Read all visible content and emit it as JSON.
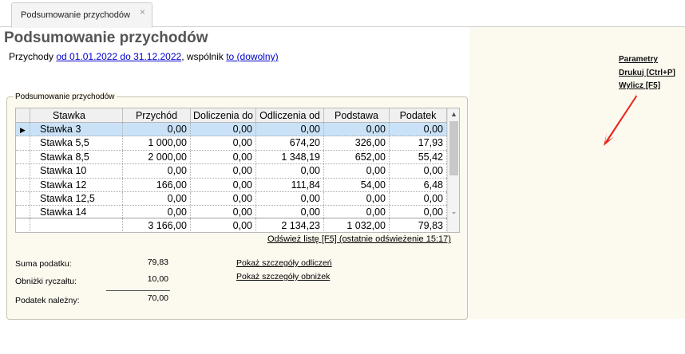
{
  "tab": {
    "label": "Podsumowanie przychodów",
    "close": "×"
  },
  "page": {
    "title": "Podsumowanie przychodów",
    "subtitle_prefix": "Przychody ",
    "date_range": "od 01.01.2022 do 31.12.2022",
    "subtitle_mid": ", wspólnik ",
    "partner": "to (dowolny)"
  },
  "side_menu": [
    "Parametry",
    "Drukuj [Ctrl+P]",
    "Wylicz [F5]"
  ],
  "accent_color": "#e8251c",
  "group": {
    "legend": "Podsumowanie przychodów"
  },
  "grid": {
    "columns": [
      "Stawka",
      "Przychód",
      "Doliczenia do",
      "Odliczenia od",
      "Podstawa",
      "Podatek"
    ],
    "rows": [
      [
        "Stawka 3",
        "0,00",
        "0,00",
        "0,00",
        "0,00",
        "0,00"
      ],
      [
        "Stawka 5,5",
        "1 000,00",
        "0,00",
        "674,20",
        "326,00",
        "17,93"
      ],
      [
        "Stawka 8,5",
        "2 000,00",
        "0,00",
        "1 348,19",
        "652,00",
        "55,42"
      ],
      [
        "Stawka 10",
        "0,00",
        "0,00",
        "0,00",
        "0,00",
        "0,00"
      ],
      [
        "Stawka 12",
        "166,00",
        "0,00",
        "111,84",
        "54,00",
        "6,48"
      ],
      [
        "Stawka 12,5",
        "0,00",
        "0,00",
        "0,00",
        "0,00",
        "0,00"
      ],
      [
        "Stawka 14",
        "0,00",
        "0,00",
        "0,00",
        "0,00",
        "0,00"
      ]
    ],
    "selected_row": 0,
    "totals": [
      "",
      "3 166,00",
      "0,00",
      "2 134,23",
      "1 032,00",
      "79,83"
    ],
    "refresh": "Odśwież listę [F5] (ostatnie odświeżenie 15:17)"
  },
  "summary": {
    "tax_sum_label": "Suma podatku:",
    "tax_sum_value": "79,83",
    "reductions_label": "Obniżki ryczałtu:",
    "reductions_value": "10,00",
    "due_label": "Podatek należny:",
    "due_value": "70,00"
  },
  "details": {
    "deductions": "Pokaż szczegóły odliczeń",
    "reductions": "Pokaż szczegóły obniżek"
  },
  "icons": {
    "row_pointer": "right-triangle",
    "scroll_up": "chevron-up",
    "scroll_down": "chevron-down"
  }
}
